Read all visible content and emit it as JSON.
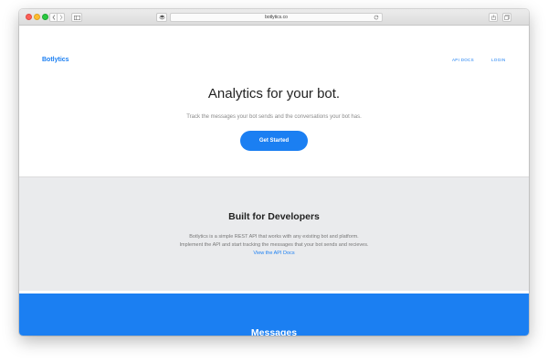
{
  "browser": {
    "url": "botlytics.co"
  },
  "site": {
    "brand": "Botlytics",
    "nav": {
      "api_docs": "API DOCS",
      "login": "LOGIN"
    },
    "hero": {
      "title": "Analytics for your bot.",
      "subtitle": "Track the messages your bot sends and the conversations your bot has.",
      "cta": "Get Started"
    },
    "developers": {
      "title": "Built for Developers",
      "line1": "Botlytics is a simple REST API that works with any existing bot and platform.",
      "line2": "Implement the API and start tracking the messages that your bot sends and recieves.",
      "link": "View the API Docs"
    },
    "messages": {
      "title": "Messages"
    }
  },
  "colors": {
    "accent": "#1b7ff2",
    "section_gray": "#eaebed"
  },
  "icons": [
    "close-traffic-light-icon",
    "minimize-traffic-light-icon",
    "zoom-traffic-light-icon",
    "back-arrow-icon",
    "forward-arrow-icon",
    "sidebar-icon",
    "layers-icon",
    "reload-icon",
    "share-icon",
    "tabs-icon"
  ]
}
